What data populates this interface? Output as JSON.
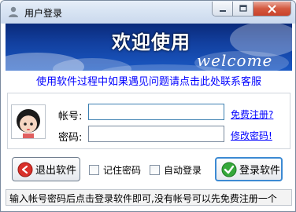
{
  "window": {
    "title": "用户登录",
    "icons": {
      "app": "user-icon",
      "minimize": "minimize-icon",
      "maximize": "maximize-icon",
      "close": "close-icon"
    }
  },
  "banner": {
    "title": "欢迎使用",
    "subtitle": "welcome"
  },
  "help_link": "使用软件过程中如果遇见问题请点击此处联系客服",
  "form": {
    "avatar_icon": "cartoon-avatar-icon",
    "username_label": "帐号:",
    "username_value": "",
    "password_label": "密码:",
    "password_value": "",
    "register_link": "免费注册?",
    "change_password_link": "修改密码!"
  },
  "actions": {
    "exit_label": "退出软件",
    "exit_icon": "exit-icon",
    "remember_label": "记住密码",
    "remember_checked": false,
    "auto_login_label": "自动登录",
    "auto_login_checked": false,
    "login_label": "登录软件",
    "login_icon": "checkmark-icon"
  },
  "status_text": "输入帐号密码后点击登录软件即可,没有帐号可以先免费注册一个",
  "colors": {
    "link": "#0000ff",
    "banner": "#123f9e",
    "close": "#c9422a"
  }
}
